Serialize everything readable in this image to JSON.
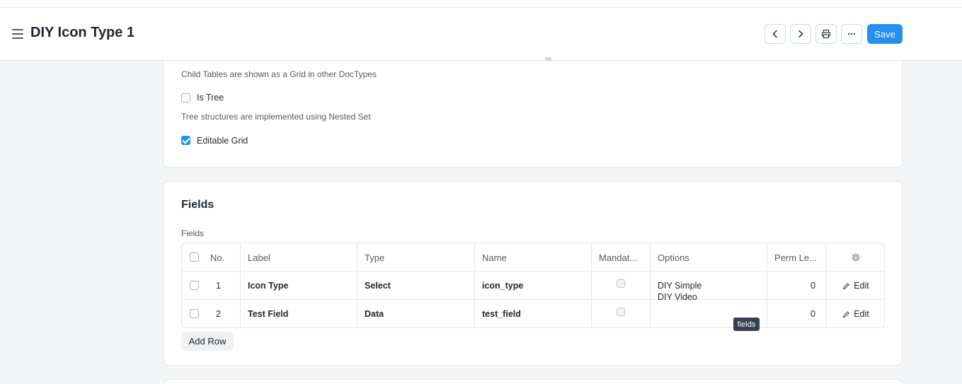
{
  "header": {
    "title": "DIY Icon Type 1",
    "save_label": "Save"
  },
  "settings": {
    "child_table_desc": "Child Tables are shown as a Grid in other DocTypes",
    "is_tree_label": "Is Tree",
    "is_tree_checked": false,
    "tree_desc": "Tree structures are implemented using Nested Set",
    "editable_grid_label": "Editable Grid",
    "editable_grid_checked": true
  },
  "fields_section": {
    "title": "Fields",
    "field_label": "Fields",
    "columns": [
      "No.",
      "Label",
      "Type",
      "Name",
      "Mandat...",
      "Options",
      "Perm Le..."
    ],
    "rows": [
      {
        "no": "1",
        "label": "Icon Type",
        "type": "Select",
        "name": "icon_type",
        "mandatory": false,
        "options": [
          "DIY Simple",
          "DIY Video"
        ],
        "perm_level": "0",
        "edit": "Edit"
      },
      {
        "no": "2",
        "label": "Test Field",
        "type": "Data",
        "name": "test_field",
        "mandatory": false,
        "options": [],
        "perm_level": "0",
        "edit": "Edit"
      }
    ],
    "add_row_label": "Add Row"
  },
  "tooltip": "fields",
  "icons": {
    "menu": "hamburger-menu-icon",
    "prev": "chevron-left-icon",
    "next": "chevron-right-icon",
    "print": "printer-icon",
    "more": "ellipsis-icon",
    "settings": "gear-icon",
    "edit": "pencil-icon"
  },
  "colors": {
    "primary": "#2490ef",
    "background": "#f4f5f6"
  }
}
